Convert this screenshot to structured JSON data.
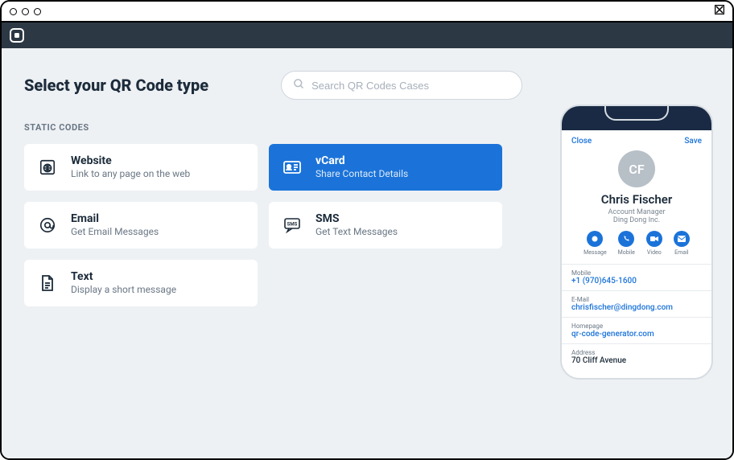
{
  "page": {
    "title": "Select your QR Code type"
  },
  "search": {
    "placeholder": "Search QR Codes Cases"
  },
  "section": {
    "static_label": "STATIC CODES"
  },
  "cards": {
    "website": {
      "title": "Website",
      "sub": "Link to any page on the web"
    },
    "vcard": {
      "title": "vCard",
      "sub": "Share Contact Details"
    },
    "email": {
      "title": "Email",
      "sub": "Get Email Messages"
    },
    "sms": {
      "title": "SMS",
      "sub": "Get Text Messages"
    },
    "text": {
      "title": "Text",
      "sub": "Display a short message"
    }
  },
  "preview": {
    "close": "Close",
    "save": "Save",
    "initials": "CF",
    "name": "Chris Fischer",
    "role": "Account Manager",
    "org": "Ding Dong Inc.",
    "actions": {
      "message": "Message",
      "mobile": "Mobile",
      "video": "Video",
      "email": "Email"
    },
    "fields": {
      "mobile_label": "Mobile",
      "mobile_value": "+1 (970)645-1600",
      "email_label": "E-Mail",
      "email_value": "chrisfischer@dingdong.com",
      "homepage_label": "Homepage",
      "homepage_value": "qr-code-generator.com",
      "address_label": "Address",
      "address_value": "70 Cliff Avenue"
    }
  }
}
